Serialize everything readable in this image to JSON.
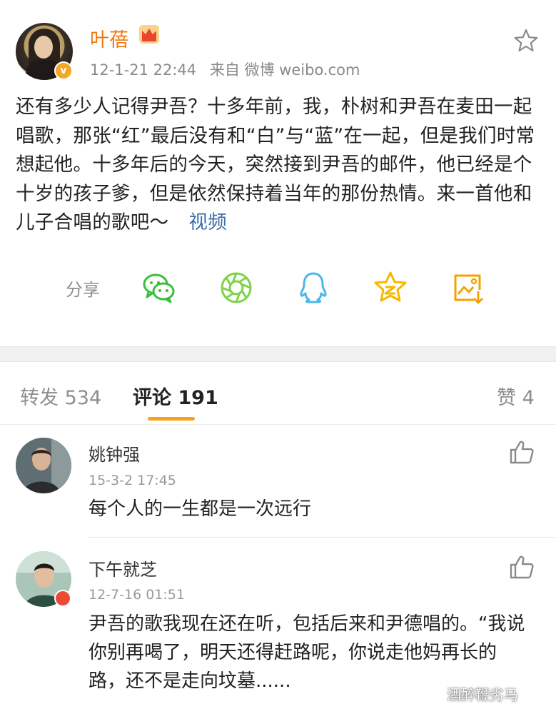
{
  "post": {
    "author": "叶蓓",
    "timestamp": "12-1-21 22:44",
    "source": "来自 微博 weibo.com",
    "text": "还有多少人记得尹吾？十多年前，我，朴树和尹吾在麦田一起唱歌，那张“红”最后没有和“白”与“蓝”在一起，但是我们时常想起他。十多年后的今天，突然接到尹吾的邮件，他已经是个十岁的孩子爹，但是依然保持着当年的那份热情。来一首他和儿子合唱的歌吧～",
    "video_link": "视频",
    "share_label": "分享",
    "share_targets": [
      "wechat-icon",
      "moments-icon",
      "qq-icon",
      "qzone-icon",
      "save-image-icon"
    ],
    "accent_color": "#f07a12",
    "link_color": "#3e6ba8"
  },
  "tabs": {
    "repost": "转发 534",
    "comments": "评论 191",
    "likes": "赞 4",
    "active": "comments",
    "underline_color": "#f7a21b"
  },
  "comments": [
    {
      "name": "姚钟强",
      "time": "15-3-2 17:45",
      "text": "每个人的一生都是一次远行"
    },
    {
      "name": "下午就芝",
      "time": "12-7-16 01:51",
      "text": "尹吾的歌我现在还在听，包括后来和尹德唱的。“我说你别再喝了，明天还得赶路呢，你说走他妈再长的路，还不是走向坟墓......"
    }
  ],
  "watermark": "酒醉鞭劣马"
}
